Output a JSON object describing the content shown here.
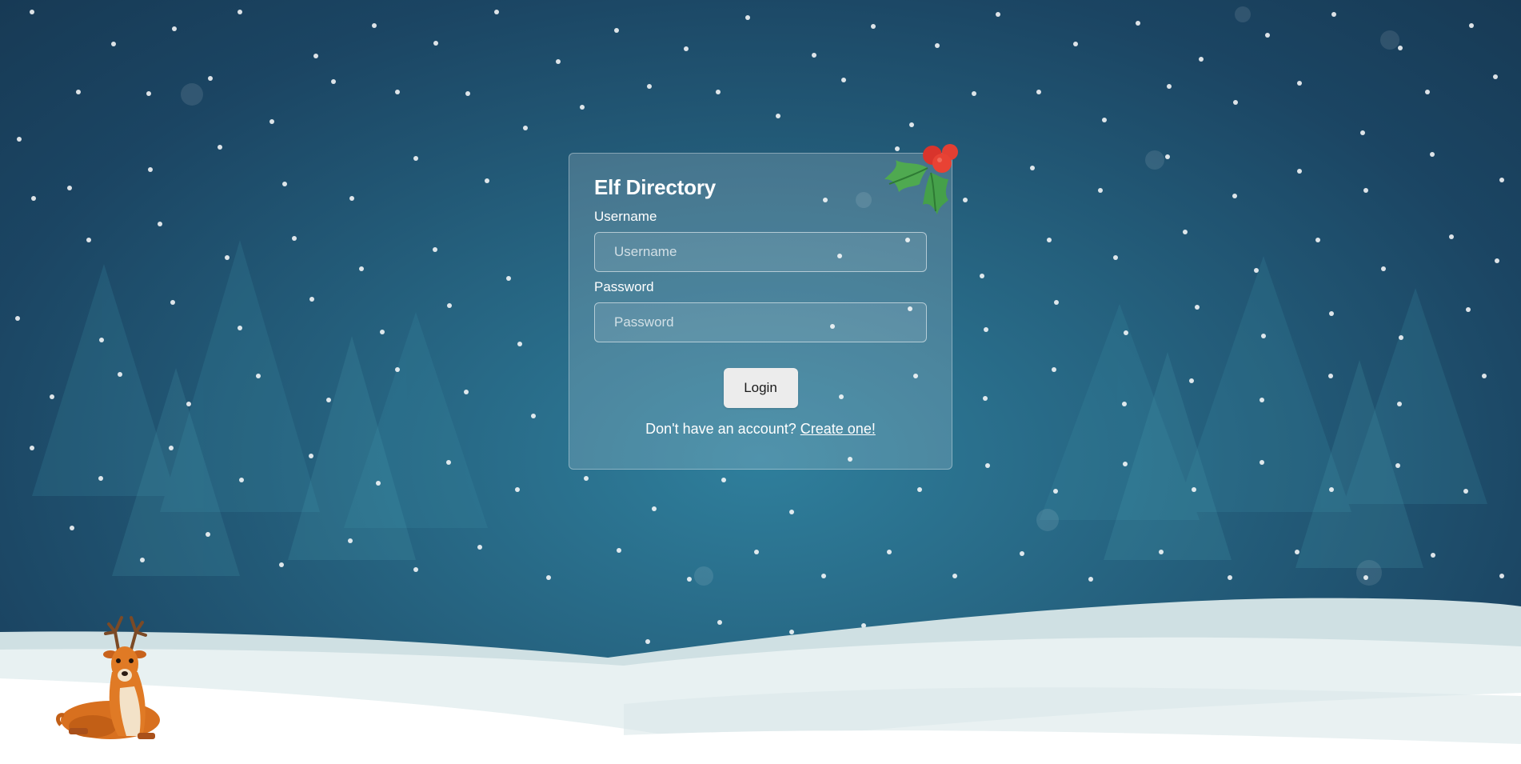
{
  "login_card": {
    "title": "Elf Directory",
    "username": {
      "label": "Username",
      "placeholder": "Username",
      "value": ""
    },
    "password": {
      "label": "Password",
      "placeholder": "Password",
      "value": ""
    },
    "login_button": "Login",
    "signup_prompt": "Don't have an account?",
    "signup_link": "Create one!"
  },
  "decorations": {
    "holly_icon": "holly-icon",
    "reindeer_icon": "reindeer-icon"
  },
  "colors": {
    "background": "#25617e",
    "button": "#ececec",
    "holly_leaf": "#3fa34d",
    "holly_berry": "#e0332f"
  }
}
